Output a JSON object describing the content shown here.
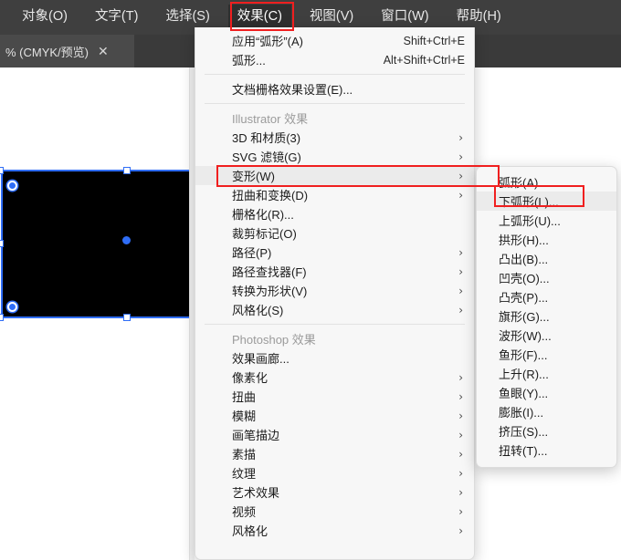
{
  "menubar": {
    "items": [
      {
        "label": "对象(O)",
        "active": false
      },
      {
        "label": "文字(T)",
        "active": false
      },
      {
        "label": "选择(S)",
        "active": false
      },
      {
        "label": "效果(C)",
        "active": true
      },
      {
        "label": "视图(V)",
        "active": false
      },
      {
        "label": "窗口(W)",
        "active": false
      },
      {
        "label": "帮助(H)",
        "active": false
      }
    ]
  },
  "tabstrip": {
    "tab_label": "% (CMYK/预览)",
    "close_glyph": "✕"
  },
  "canvas": {
    "shape_fill": "#000000",
    "selection_color": "#2f6df6"
  },
  "dropdown": {
    "items": [
      {
        "label": "应用“弧形”(A)",
        "shortcut": "Shift+Ctrl+E",
        "arrow": "",
        "state": "normal"
      },
      {
        "label": "弧形...",
        "shortcut": "Alt+Shift+Ctrl+E",
        "arrow": "",
        "state": "normal"
      },
      {
        "type": "separator"
      },
      {
        "label": "文档栅格效果设置(E)...",
        "shortcut": "",
        "arrow": "",
        "state": "normal"
      },
      {
        "type": "separator"
      },
      {
        "label": "Illustrator 效果",
        "shortcut": "",
        "arrow": "",
        "state": "header"
      },
      {
        "label": "3D 和材质(3)",
        "shortcut": "",
        "arrow": "›",
        "state": "normal"
      },
      {
        "label": "SVG 滤镜(G)",
        "shortcut": "",
        "arrow": "›",
        "state": "normal"
      },
      {
        "label": "变形(W)",
        "shortcut": "",
        "arrow": "›",
        "state": "highlighted"
      },
      {
        "label": "扭曲和变换(D)",
        "shortcut": "",
        "arrow": "›",
        "state": "normal"
      },
      {
        "label": "栅格化(R)...",
        "shortcut": "",
        "arrow": "",
        "state": "normal"
      },
      {
        "label": "裁剪标记(O)",
        "shortcut": "",
        "arrow": "",
        "state": "normal"
      },
      {
        "label": "路径(P)",
        "shortcut": "",
        "arrow": "›",
        "state": "normal"
      },
      {
        "label": "路径查找器(F)",
        "shortcut": "",
        "arrow": "›",
        "state": "normal"
      },
      {
        "label": "转换为形状(V)",
        "shortcut": "",
        "arrow": "›",
        "state": "normal"
      },
      {
        "label": "风格化(S)",
        "shortcut": "",
        "arrow": "›",
        "state": "normal"
      },
      {
        "type": "separator"
      },
      {
        "label": "Photoshop 效果",
        "shortcut": "",
        "arrow": "",
        "state": "header"
      },
      {
        "label": "效果画廊...",
        "shortcut": "",
        "arrow": "",
        "state": "normal"
      },
      {
        "label": "像素化",
        "shortcut": "",
        "arrow": "›",
        "state": "normal"
      },
      {
        "label": "扭曲",
        "shortcut": "",
        "arrow": "›",
        "state": "normal"
      },
      {
        "label": "模糊",
        "shortcut": "",
        "arrow": "›",
        "state": "normal"
      },
      {
        "label": "画笔描边",
        "shortcut": "",
        "arrow": "›",
        "state": "normal"
      },
      {
        "label": "素描",
        "shortcut": "",
        "arrow": "›",
        "state": "normal"
      },
      {
        "label": "纹理",
        "shortcut": "",
        "arrow": "›",
        "state": "normal"
      },
      {
        "label": "艺术效果",
        "shortcut": "",
        "arrow": "›",
        "state": "normal"
      },
      {
        "label": "视频",
        "shortcut": "",
        "arrow": "›",
        "state": "normal"
      },
      {
        "label": "风格化",
        "shortcut": "",
        "arrow": "›",
        "state": "normal"
      }
    ]
  },
  "submenu": {
    "items": [
      {
        "label": "弧形(A)...",
        "state": "normal"
      },
      {
        "label": "下弧形(L)...",
        "state": "highlighted"
      },
      {
        "label": "上弧形(U)...",
        "state": "normal"
      },
      {
        "label": "拱形(H)...",
        "state": "normal"
      },
      {
        "label": "凸出(B)...",
        "state": "normal"
      },
      {
        "label": "凹壳(O)...",
        "state": "normal"
      },
      {
        "label": "凸壳(P)...",
        "state": "normal"
      },
      {
        "label": "旗形(G)...",
        "state": "normal"
      },
      {
        "label": "波形(W)...",
        "state": "normal"
      },
      {
        "label": "鱼形(F)...",
        "state": "normal"
      },
      {
        "label": "上升(R)...",
        "state": "normal"
      },
      {
        "label": "鱼眼(Y)...",
        "state": "normal"
      },
      {
        "label": "膨胀(I)...",
        "state": "normal"
      },
      {
        "label": "挤压(S)...",
        "state": "normal"
      },
      {
        "label": "扭转(T)...",
        "state": "normal"
      }
    ]
  },
  "annotations": {
    "highlight_color": "#f01f1f",
    "boxes": [
      "menubar-effect",
      "transform-item",
      "lower-arc-item"
    ]
  }
}
